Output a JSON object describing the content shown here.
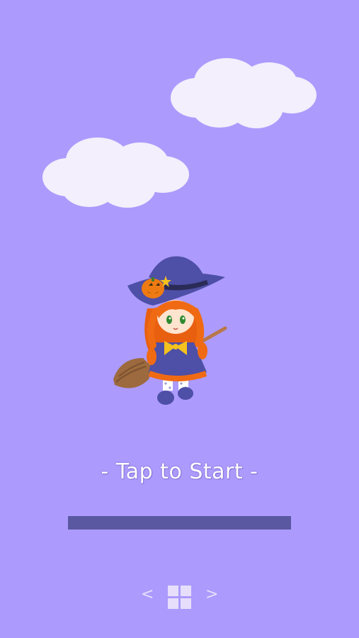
{
  "game": {
    "start_prompt": "- Tap to Start -",
    "progress": 1.0
  },
  "nav": {
    "prev_label": "<",
    "next_label": ">",
    "menu_icon": "grid-icon"
  },
  "colors": {
    "background": "#ac9bfd",
    "cloud": "#f3effc",
    "progress_bar": "#5a58a0",
    "nav_icons": "#e7defb",
    "hat": "#4e4fa6",
    "hair": "#f06a13",
    "pumpkin": "#ee7a12"
  }
}
